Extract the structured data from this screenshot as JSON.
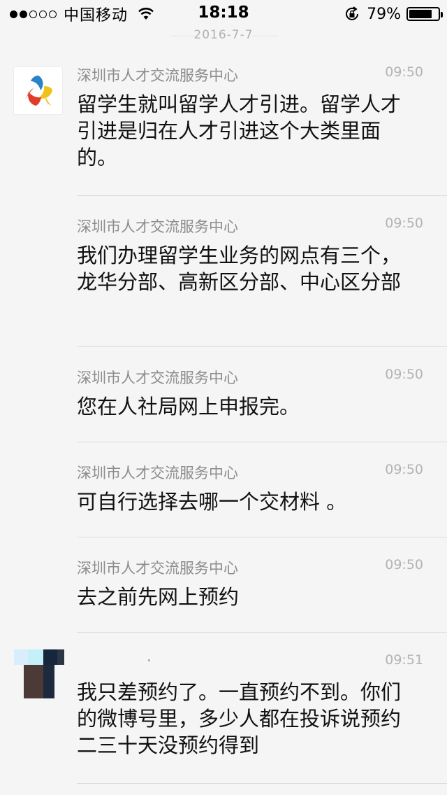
{
  "status_bar": {
    "carrier": "中国移动",
    "time": "18:18",
    "battery_percent": "79%",
    "battery_level": 0.79
  },
  "date_divider": "2016-7-7",
  "messages": [
    {
      "sender": "深圳市人才交流服务中心",
      "time": "09:50",
      "text": "留学生就叫留学人才引进。留学人才引进是归在人才引进这个大类里面的。"
    },
    {
      "sender": "深圳市人才交流服务中心",
      "time": "09:50",
      "text": "我们办理留学生业务的网点有三个，龙华分部、高新区分部、中心区分部"
    },
    {
      "sender": "深圳市人才交流服务中心",
      "time": "09:50",
      "text": "您在人社局网上申报完。"
    },
    {
      "sender": "深圳市人才交流服务中心",
      "time": "09:50",
      "text": "可自行选择去哪一个交材料 。"
    },
    {
      "sender": "深圳市人才交流服务中心",
      "time": "09:50",
      "text": "去之前先网上预约"
    },
    {
      "sender": ".",
      "time": "09:51",
      "text": "我只差预约了。一直预约不到。你们的微博号里，多少人都在投诉说预约二三十天没预约得到"
    }
  ],
  "icons": {
    "signal": "signal-dots-icon",
    "wifi": "wifi-icon",
    "rotation_lock": "rotation-lock-icon",
    "battery": "battery-icon"
  }
}
